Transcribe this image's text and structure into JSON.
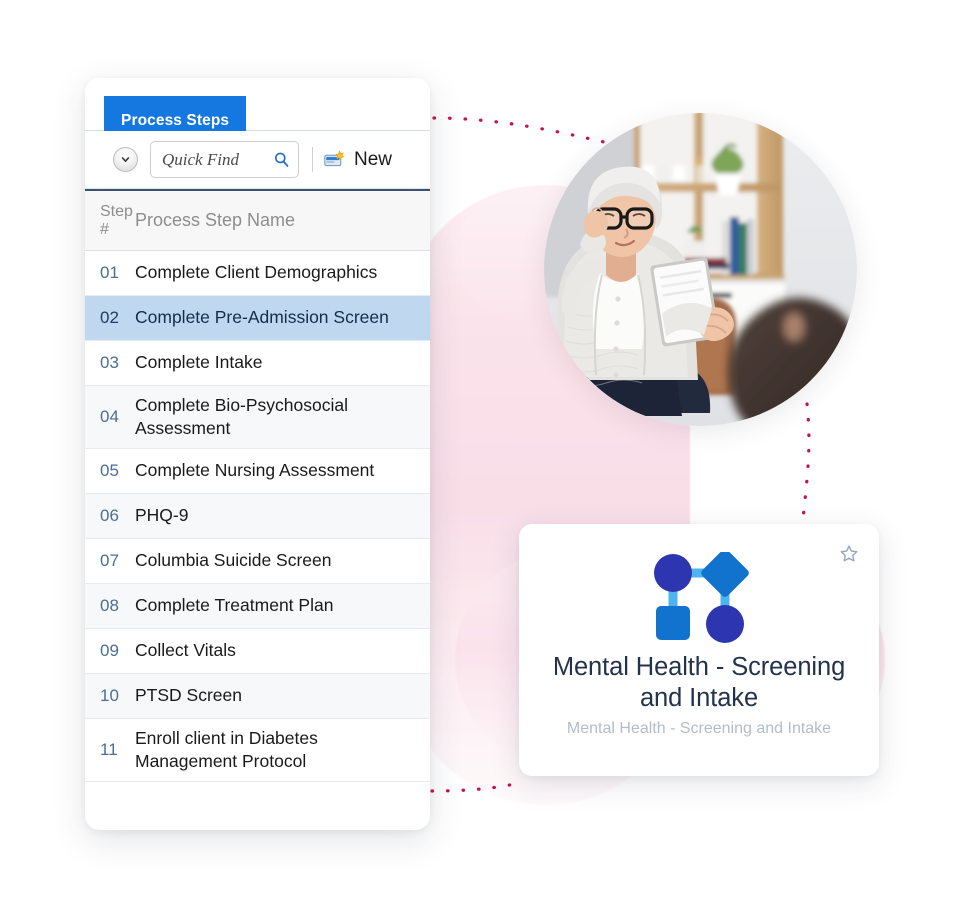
{
  "panel": {
    "tab_label": "Process Steps",
    "toolbar": {
      "dropdown_icon": "chevron-down-icon",
      "search_placeholder": "Quick Find",
      "search_value": "",
      "search_icon": "search-icon",
      "new_icon": "new-record-icon",
      "new_label": "New"
    },
    "grid": {
      "columns": [
        "Step #",
        "Process Step Name"
      ],
      "column_num_line1": "Step",
      "column_num_line2": "#",
      "rows": [
        {
          "num": "01",
          "name": "Complete Client Demographics",
          "selected": false
        },
        {
          "num": "02",
          "name": "Complete Pre-Admission Screen",
          "selected": true
        },
        {
          "num": "03",
          "name": "Complete Intake",
          "selected": false
        },
        {
          "num": "04",
          "name": "Complete Bio-Psychosocial Assessment",
          "selected": false
        },
        {
          "num": "05",
          "name": "Complete Nursing Assessment",
          "selected": false
        },
        {
          "num": "06",
          "name": "PHQ-9",
          "selected": false
        },
        {
          "num": "07",
          "name": "Columbia Suicide Screen",
          "selected": false
        },
        {
          "num": "08",
          "name": "Complete Treatment Plan",
          "selected": false
        },
        {
          "num": "09",
          "name": "Collect Vitals",
          "selected": false
        },
        {
          "num": "10",
          "name": "PTSD Screen",
          "selected": false
        },
        {
          "num": "11",
          "name": "Enroll client in Diabetes Management Protocol",
          "selected": false
        }
      ]
    }
  },
  "photo": {
    "alt": "Older woman with glasses holding a tablet in conversation with a client",
    "icon": "counseling-session-photo"
  },
  "card": {
    "star_icon": "favorite-star-icon",
    "workflow_icon": "workflow-diagram-icon",
    "title": "Mental Health - Screening and Intake",
    "subtitle": "Mental Health - Screening and Intake"
  },
  "colors": {
    "tab_blue": "#1577e0",
    "row_selected": "#bfd8f0",
    "row_alt": "#f7f8f9",
    "step_number": "#4b6e96",
    "card_title": "#22334b",
    "card_subtitle": "#b4bcc8",
    "connector_dot": "#c4134a",
    "background_accent": "#fbe4ec",
    "grid_header_border": "#39526e",
    "icon_dark_blue": "#2e35b0",
    "icon_mid_blue": "#1273ce",
    "icon_light_blue": "#4cb4ef"
  }
}
